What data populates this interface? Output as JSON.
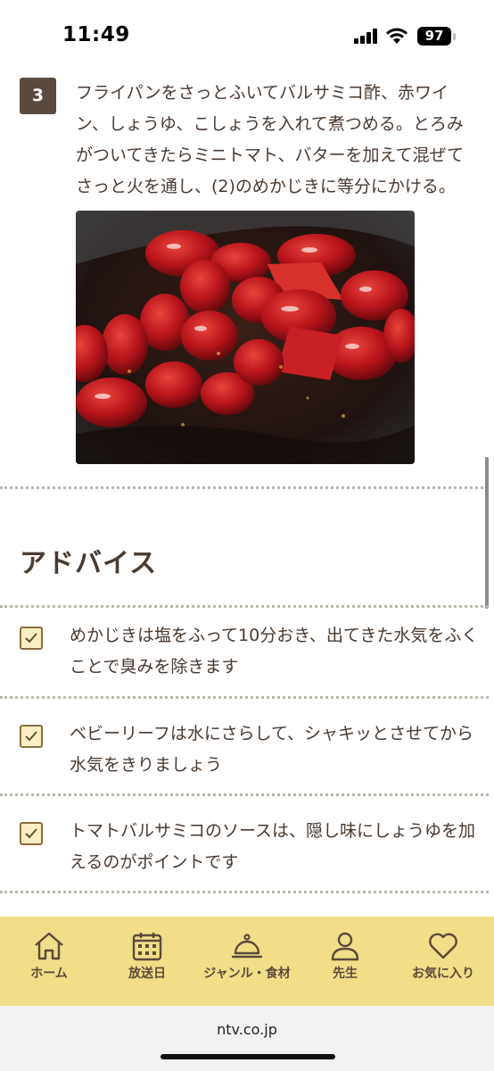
{
  "status_bar": {
    "time": "11:49",
    "battery": "97"
  },
  "step": {
    "number": "3",
    "text": "フライパンをさっとふいてバルサミコ酢、赤ワイン、しょうゆ、こしょうを入れて煮つめる。とろみがついてきたらミニトマト、バターを加えて混ぜてさっと火を通し、(2)のめかじきに等分にかける。",
    "photo_icon": "tomato-sauce-photo"
  },
  "advice": {
    "heading": "アドバイス",
    "items": [
      {
        "text": "めかじきは塩をふって10分おき、出てきた水気をふくことで臭みを除きます",
        "checked": true
      },
      {
        "text": "ベビーリーフは水にさらして、シャキッとさせてから水気をきりましょう",
        "checked": true
      },
      {
        "text": "トマトバルサミコのソースは、隠し味にしょうゆを加えるのがポイントです",
        "checked": true
      }
    ]
  },
  "bottom_nav": {
    "items": [
      {
        "label": "ホーム",
        "icon": "home-icon"
      },
      {
        "label": "放送日",
        "icon": "calendar-icon"
      },
      {
        "label": "ジャンル・食材",
        "icon": "cloche-icon"
      },
      {
        "label": "先生",
        "icon": "person-icon"
      },
      {
        "label": "お気に入り",
        "icon": "heart-icon"
      }
    ]
  },
  "browser": {
    "url": "ntv.co.jp"
  },
  "colors": {
    "nav_bg": "#f0de88",
    "text": "#4a3a30",
    "badge": "#5a4a40",
    "checkbox_bg": "#fbf0c4"
  }
}
